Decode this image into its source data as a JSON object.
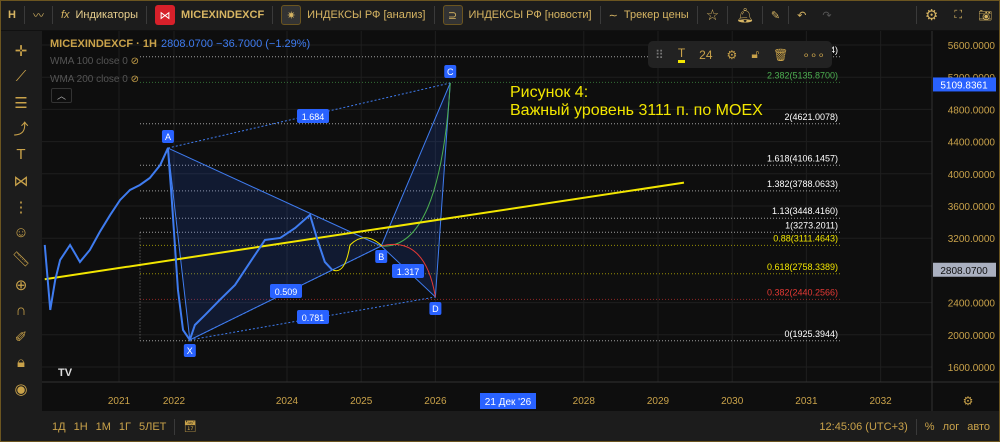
{
  "toolbar": {
    "interval": "Н",
    "indicators": "Индикаторы",
    "symbol": "MICEXINDEXCF",
    "tab1": "ИНДЕКСЫ РФ [анализ]",
    "tab2": "ИНДЕКСЫ РФ [новости]",
    "tracker": "Трекер цены"
  },
  "legend": {
    "symbol": "MICEXINDEXCF · 1Н",
    "values": "2808.0700 −36.7000 (−1.29%)",
    "wma100": "WMA 100 close 0",
    "wma200": "WMA 200 close 0"
  },
  "floatbar": {
    "font_size": "24"
  },
  "annotation": {
    "line1": "Рисунок 4:",
    "line2": "Важный уровень 3111 п. по MOEX"
  },
  "bottom": {
    "ranges": [
      "1Д",
      "1Н",
      "1М",
      "1Г",
      "5ЛЕТ"
    ],
    "time": "12:45:06 (UTC+3)",
    "percent": "%",
    "log": "лог",
    "auto": "авто"
  },
  "colors": {
    "accent": "#c9a24a",
    "price": "#3f7cf0",
    "trend": "#f2e600"
  },
  "chart_data": {
    "type": "line",
    "x_ticks": [
      "2021",
      "2022",
      "2024",
      "2025",
      "2026",
      "2028",
      "2029",
      "2030",
      "2031",
      "2032"
    ],
    "x_cursor_label": "21 Дек '26",
    "y_ticks": [
      "5600.0000",
      "5200.0000",
      "4800.0000",
      "4400.0000",
      "4000.0000",
      "3600.0000",
      "3200.0000",
      "2400.0000",
      "2000.0000",
      "1600.0000"
    ],
    "last_price": "2808.0700",
    "crosshair_price": "5109.8361",
    "series": [
      {
        "name": "MICEXINDEXCF",
        "points": [
          [
            2019.65,
            3116
          ],
          [
            2019.75,
            2309
          ],
          [
            2019.84,
            2681
          ],
          [
            2019.93,
            2930
          ],
          [
            2020.11,
            3116
          ],
          [
            2020.29,
            2905
          ],
          [
            2020.47,
            3054
          ],
          [
            2020.65,
            3277
          ],
          [
            2020.84,
            3489
          ],
          [
            2021.02,
            3675
          ],
          [
            2021.2,
            3799
          ],
          [
            2021.38,
            3861
          ],
          [
            2021.56,
            3948
          ],
          [
            2021.75,
            4110
          ],
          [
            2021.89,
            4320
          ],
          [
            2021.96,
            3675
          ],
          [
            2022.07,
            2557
          ],
          [
            2022.16,
            2060
          ],
          [
            2022.28,
            1936
          ],
          [
            2022.37,
            2122
          ],
          [
            2022.55,
            2247
          ],
          [
            2022.81,
            2433
          ],
          [
            2023.08,
            2619
          ],
          [
            2023.35,
            2905
          ],
          [
            2023.61,
            3178
          ],
          [
            2023.88,
            3203
          ],
          [
            2024.11,
            3327
          ],
          [
            2024.31,
            3489
          ],
          [
            2024.41,
            3178
          ],
          [
            2024.51,
            2905
          ],
          [
            2024.61,
            2806
          ]
        ]
      }
    ],
    "fib_levels": [
      {
        "label": "2.618(5453.9524)",
        "price": 5453.95,
        "color": "#ffffff"
      },
      {
        "label": "2.382(5135.8700)",
        "price": 5135.87,
        "color": "#4caf50"
      },
      {
        "label": "2(4621.0078)",
        "price": 4621.01,
        "color": "#ffffff"
      },
      {
        "label": "1.618(4106.1457)",
        "price": 4106.15,
        "color": "#ffffff"
      },
      {
        "label": "1.382(3788.0633)",
        "price": 3788.06,
        "color": "#ffffff"
      },
      {
        "label": "1.13(3448.4160)",
        "price": 3448.42,
        "color": "#ffffff"
      },
      {
        "label": "1(3273.2011)",
        "price": 3273.2,
        "color": "#ffffff"
      },
      {
        "label": "0.88(3111.4643)",
        "price": 3111.46,
        "color": "#f2e600"
      },
      {
        "label": "0.618(2758.3389)",
        "price": 2758.34,
        "color": "#f2e600"
      },
      {
        "label": "0.382(2440.2566)",
        "price": 2440.26,
        "color": "#e53935"
      },
      {
        "label": "0(1925.3944)",
        "price": 1925.39,
        "color": "#ffffff"
      }
    ],
    "pattern": {
      "points": [
        {
          "label": "X",
          "t": 2022.28,
          "p": 1936
        },
        {
          "label": "A",
          "t": 2021.89,
          "p": 4320
        },
        {
          "label": "B",
          "t": 2025.27,
          "p": 3103
        },
        {
          "label": "C",
          "t": 2026.2,
          "p": 5128
        },
        {
          "label": "D",
          "t": 2026.0,
          "p": 2470
        }
      ],
      "ratios": [
        "1.684",
        "0.509",
        "1.317",
        "0.781"
      ]
    },
    "trendline": {
      "from": [
        2019.65,
        2690
      ],
      "to": [
        2029.35,
        3890
      ]
    }
  }
}
